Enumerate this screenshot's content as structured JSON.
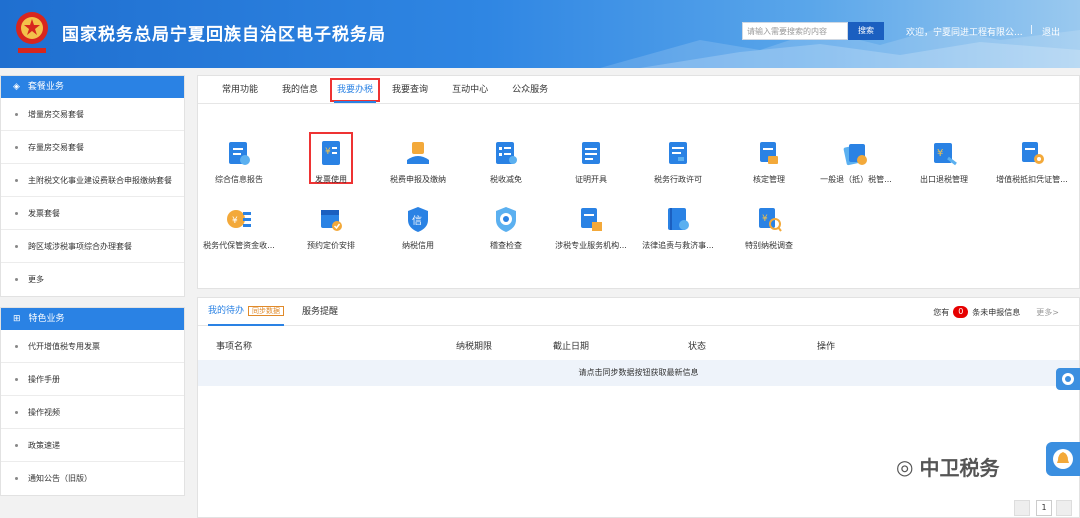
{
  "header": {
    "title": "国家税务总局宁夏回族自治区电子税务局",
    "search_placeholder": "请输入需要搜索的内容",
    "search_button": "搜索",
    "welcome": "欢迎，宁夏同进工程有限公...",
    "separator": "|",
    "logout": "退出"
  },
  "sidebar": {
    "groups": [
      {
        "title": "套餐业务",
        "items": [
          "增量房交易套餐",
          "存量房交易套餐",
          "主附税文化事业建设费联合申报缴纳套餐",
          "发票套餐",
          "跨区域涉税事项综合办理套餐",
          "更多"
        ]
      },
      {
        "title": "特色业务",
        "items": [
          "代开增值税专用发票",
          "操作手册",
          "操作视频",
          "政策速递",
          "通知公告（旧版）"
        ]
      }
    ]
  },
  "tabs": [
    "常用功能",
    "我的信息",
    "我要办税",
    "我要查询",
    "互动中心",
    "公众服务"
  ],
  "active_tab": "我要办税",
  "services": [
    "综合信息报告",
    "发票使用",
    "税费申报及缴纳",
    "税收减免",
    "证明开具",
    "税务行政许可",
    "核定管理",
    "一般退（抵）税管...",
    "出口退税管理",
    "增值税抵扣凭证管...",
    "税务代保管资金收...",
    "预约定价安排",
    "纳税信用",
    "稽查检查",
    "涉税专业服务机构...",
    "法律追责与救济事...",
    "特别纳税调查"
  ],
  "todo": {
    "tabs": [
      "我的待办",
      "服务提醒"
    ],
    "sync_badge": "同步数据",
    "prefix": "您有",
    "count": "0",
    "suffix": "条未申报信息",
    "more": "更多>",
    "columns": [
      "事项名称",
      "纳税期限",
      "截止日期",
      "状态",
      "操作"
    ],
    "empty_message": "请点击同步数据按钮获取最新信息",
    "page": "1"
  },
  "watermark": "中卫税务",
  "colors": {
    "primary": "#2a82e4",
    "highlight": "#e33333"
  }
}
